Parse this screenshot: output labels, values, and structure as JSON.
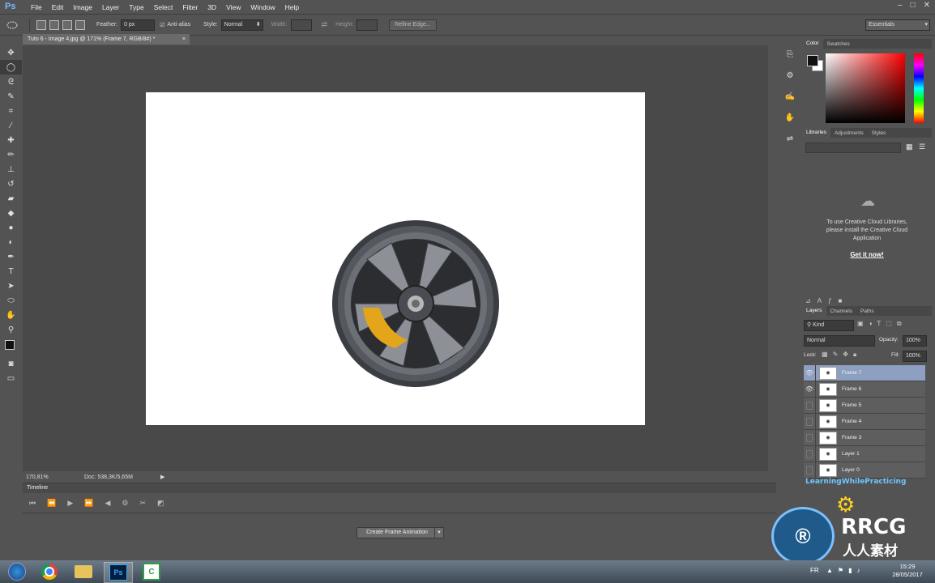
{
  "app": {
    "logo": "Ps"
  },
  "menu": [
    "File",
    "Edit",
    "Image",
    "Layer",
    "Type",
    "Select",
    "Filter",
    "3D",
    "View",
    "Window",
    "Help"
  ],
  "window_controls": [
    "–",
    "□",
    "✕"
  ],
  "options": {
    "feather_label": "Feather:",
    "feather_value": "0 px",
    "antialias_label": "Anti-alias",
    "style_label": "Style:",
    "style_value": "Normal",
    "width_label": "Width:",
    "height_label": "Height:",
    "refine_edge": "Refine Edge...",
    "workspace": "Essentials"
  },
  "document": {
    "tab_title": "Tuto 6 - Image 4.jpg @ 171% (Frame 7, RGB/8#) *",
    "close": "×"
  },
  "status": {
    "zoom": "170,81%",
    "doc": "Doc: 538,3K/5,65M"
  },
  "timeline": {
    "title": "Timeline",
    "create_button": "Create Frame Animation"
  },
  "color_panel": {
    "tabs": [
      "Color",
      "Swatches"
    ]
  },
  "libraries_panel": {
    "tabs": [
      "Libraries",
      "Adjustments",
      "Styles"
    ],
    "message": "To use Creative Cloud Libraries, please install the Creative Cloud Application",
    "link": "Get it now!"
  },
  "layers_panel": {
    "tabs": [
      "Layers",
      "Channels",
      "Paths"
    ],
    "filter_value": "Kind",
    "blend_mode": "Normal",
    "opacity_label": "Opacity:",
    "opacity_value": "100%",
    "lock_label": "Lock:",
    "fill_label": "Fill:",
    "fill_value": "100%",
    "layers": [
      {
        "name": "Frame 7",
        "visible": true,
        "selected": true
      },
      {
        "name": "Frame 6",
        "visible": true,
        "selected": false
      },
      {
        "name": "Frame 5",
        "visible": false,
        "selected": false
      },
      {
        "name": "Frame 4",
        "visible": false,
        "selected": false
      },
      {
        "name": "Frame 3",
        "visible": false,
        "selected": false
      },
      {
        "name": "Layer 1",
        "visible": false,
        "selected": false
      },
      {
        "name": "Layer 0",
        "visible": false,
        "selected": false
      }
    ]
  },
  "overlay": {
    "learning": "LearningWhilePracticing",
    "brand": "RRCG",
    "brand_cn": "人人素材"
  },
  "taskbar": {
    "language": "FR",
    "time": "15:29",
    "date": "28/05/2017"
  }
}
